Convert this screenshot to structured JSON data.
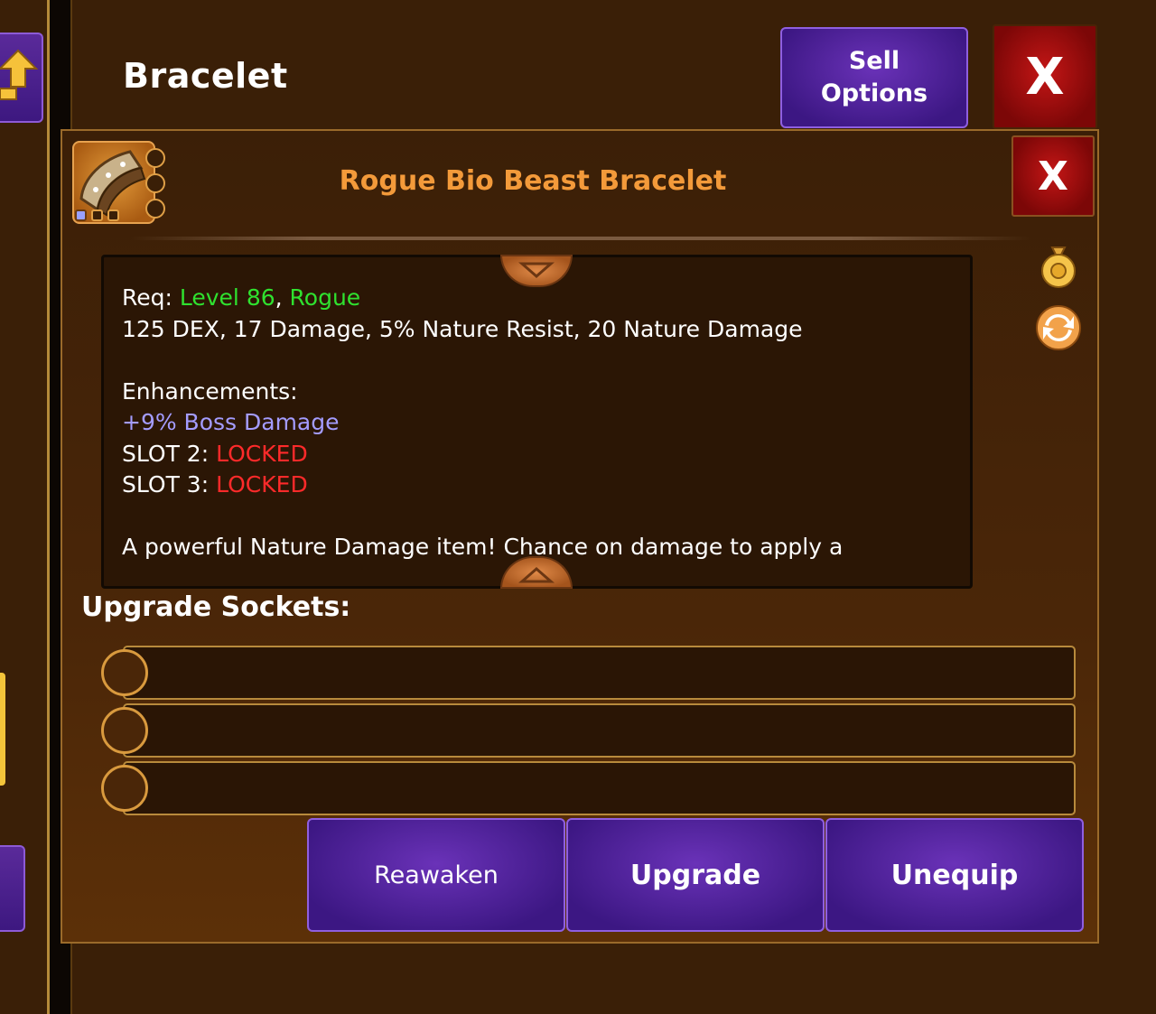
{
  "header": {
    "title": "Bracelet",
    "sell_options_label": "Sell Options",
    "close_label": "X"
  },
  "item": {
    "name": "Rogue Bio Beast Bracelet",
    "close_label": "X",
    "name_color": "#f39a3a",
    "icon": "bracelet-icon"
  },
  "description": {
    "req_prefix": "Req: ",
    "req_level": "Level 86",
    "req_sep": ", ",
    "req_class": "Rogue",
    "stats": "125 DEX, 17 Damage, 5% Nature Resist, 20 Nature Damage",
    "enhancements_header": "Enhancements:",
    "enhancement_1": "+9% Boss Damage",
    "slot2_label": "SLOT 2: ",
    "slot2_value": "LOCKED",
    "slot3_label": "SLOT 3: ",
    "slot3_value": "LOCKED",
    "flavor": "A powerful Nature Damage item! Chance on damage to apply a"
  },
  "sockets": {
    "label": "Upgrade Sockets:"
  },
  "actions": {
    "reawaken": "Reawaken",
    "upgrade": "Upgrade",
    "unequip": "Unequip"
  },
  "side_icons": [
    "gold-bag-icon",
    "swap-icon"
  ],
  "colors": {
    "requirement_green": "#2fe12f",
    "enhancement_purple": "#a49cff",
    "locked_red": "#ff2a2a",
    "button_purple": "#4a1f94",
    "close_red": "#b01010"
  }
}
